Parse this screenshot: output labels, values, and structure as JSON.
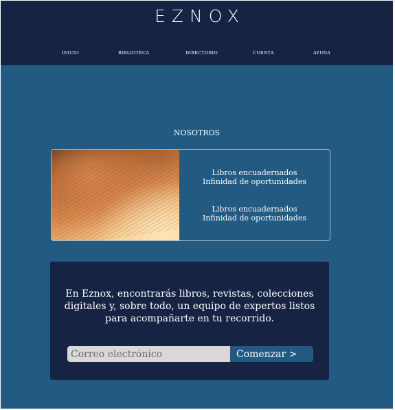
{
  "header": {
    "logo": "EZNOX",
    "nav": [
      "INICIO",
      "BIBLIOTECA",
      "DIRECTORIO",
      "CUENTA",
      "AYUDA"
    ]
  },
  "about": {
    "title": "NOSOTROS",
    "lines": [
      "Libros encuadernados",
      "Infinidad de oportunidades",
      "Libros encuadernados",
      "Infinidad de oportunidades"
    ]
  },
  "cta": {
    "text": "En Eznox, encontrarás libros, revistas, colecciones digitales y, sobre todo, un equipo de expertos listos para acompañarte en tu recorrido.",
    "email_placeholder": "Correo electrónico",
    "button_label": "Comenzar >"
  },
  "colors": {
    "header_bg": "#162342",
    "page_bg": "#225a82",
    "input_bg": "#d9d9d9"
  },
  "image": {
    "subject": "open-book-photo"
  }
}
